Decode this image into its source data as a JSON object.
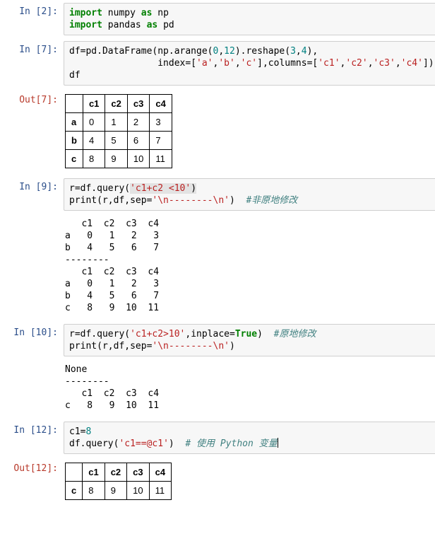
{
  "prompts": {
    "in2": "In  [2]:",
    "in7": "In  [7]:",
    "out7": "Out[7]:",
    "in9": "In  [9]:",
    "in10": "In [10]:",
    "in12": "In [12]:",
    "out12": "Out[12]:"
  },
  "cell2": {
    "l1_import": "import",
    "l1_mod": " numpy ",
    "l1_as": "as",
    "l1_alias": " np",
    "l2_import": "import",
    "l2_mod": " pandas ",
    "l2_as": "as",
    "l2_alias": " pd"
  },
  "cell7": {
    "p1": "df=pd.DataFrame(np.arange(",
    "n1": "0",
    "c1": ",",
    "n2": "12",
    "p2": ").reshape(",
    "n3": "3",
    "c2": ",",
    "n4": "4",
    "p3": "),",
    "indent": "                ",
    "p4": "index=[",
    "sA": "'a'",
    "sB": "'b'",
    "sC": "'c'",
    "p5": "],columns=[",
    "sc1": "'c1'",
    "sc2": "'c2'",
    "sc3": "'c3'",
    "sc4": "'c4'",
    "p6": "])",
    "l3": "df"
  },
  "out7": {
    "cols": [
      "c1",
      "c2",
      "c3",
      "c4"
    ],
    "rows": [
      {
        "idx": "a",
        "vals": [
          "0",
          "1",
          "2",
          "3"
        ]
      },
      {
        "idx": "b",
        "vals": [
          "4",
          "5",
          "6",
          "7"
        ]
      },
      {
        "idx": "c",
        "vals": [
          "8",
          "9",
          "10",
          "11"
        ]
      }
    ]
  },
  "cell9": {
    "p1": "r=df.query(",
    "s1": "'c1+c2 <10'",
    "p2": ")",
    "p3": "print(r,df,sep=",
    "s2": "'\\n--------\\n'",
    "p4": ")  ",
    "cm": "#非原地修改"
  },
  "out9": "   c1  c2  c3  c4\na   0   1   2   3\nb   4   5   6   7\n--------\n   c1  c2  c3  c4\na   0   1   2   3\nb   4   5   6   7\nc   8   9  10  11",
  "cell10": {
    "p1": "r=df.query(",
    "s1": "'c1+c2>10'",
    "p2": ",inplace=",
    "kw": "True",
    "p3": ")  ",
    "cm1": "#原地修改",
    "p4": "print(r,df,sep=",
    "s2": "'\\n--------\\n'",
    "p5": ")"
  },
  "out10": "None\n--------\n   c1  c2  c3  c4\nc   8   9  10  11",
  "cell12": {
    "p1": "c1=",
    "n1": "8",
    "p2": "df.query(",
    "s1": "'c1==@c1'",
    "p3": ")  ",
    "cm": "# 使用 Python 变量"
  },
  "out12": {
    "cols": [
      "c1",
      "c2",
      "c3",
      "c4"
    ],
    "rows": [
      {
        "idx": "c",
        "vals": [
          "8",
          "9",
          "10",
          "11"
        ]
      }
    ]
  }
}
